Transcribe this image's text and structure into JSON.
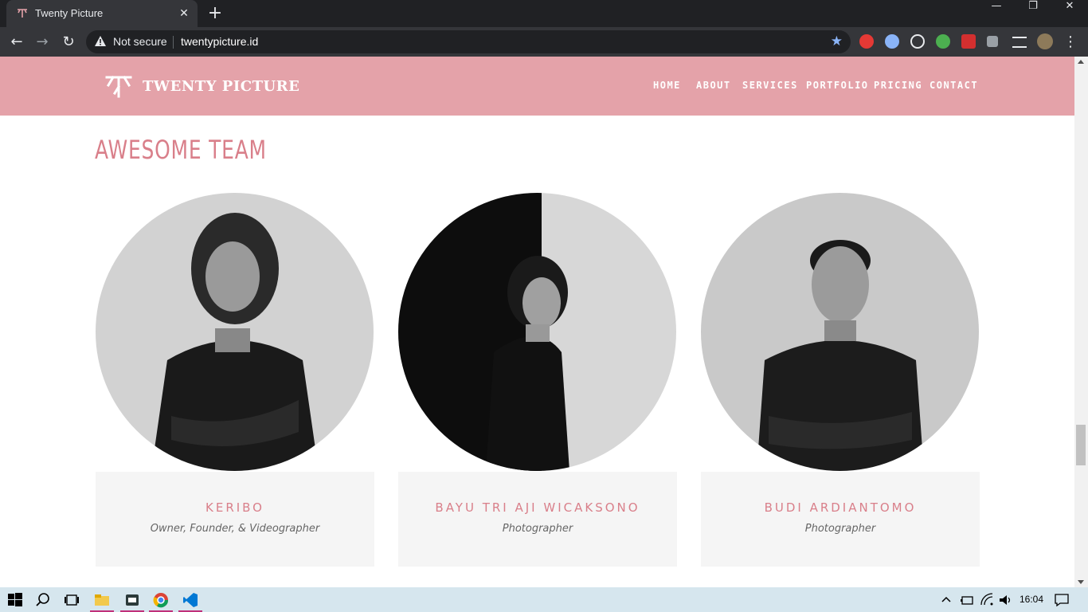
{
  "browser": {
    "tab_title": "Twenty Picture",
    "tab_close": "✕",
    "new_tab": "+",
    "security_label": "Not secure",
    "url": "twentypicture.id",
    "window_minimize": "—",
    "window_restore": "❐",
    "window_close": "✕",
    "back": "←",
    "forward": "→",
    "reload": "↻",
    "star": "★",
    "menu": "⋮"
  },
  "site": {
    "logo_text": "TWENTY PICTURE",
    "nav": [
      "HOME",
      "ABOUT",
      "SERVICES",
      "PORTFOLIO",
      "PRICING",
      "CONTACT"
    ],
    "section_title": "AWESOME TEAM",
    "team": [
      {
        "name": "KERIBO",
        "role": "Owner, Founder, & Videographer"
      },
      {
        "name": "BAYU TRI AJI WICAKSONO",
        "role": "Photographer"
      },
      {
        "name": "BUDI ARDIANTOMO",
        "role": "Photographer"
      }
    ]
  },
  "taskbar": {
    "time": "16:04"
  },
  "colors": {
    "accent_pink": "#e4a2a9",
    "title_pink": "#d97f8a"
  }
}
